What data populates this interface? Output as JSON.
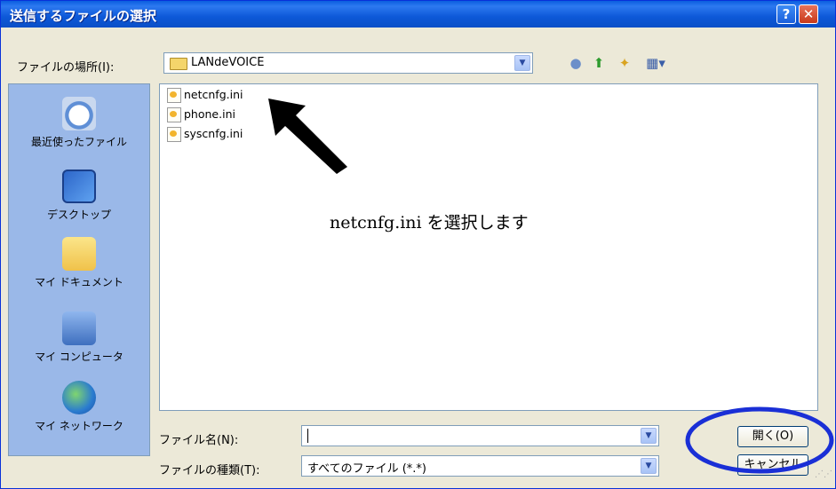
{
  "window": {
    "title": "送信するファイルの選択",
    "help_label": "?",
    "close_label": "✕"
  },
  "location": {
    "label": "ファイルの場所(I):",
    "value": "LANdeVOICE"
  },
  "toolbar_icons": [
    "back-icon",
    "up-folder-icon",
    "new-folder-icon",
    "view-menu-icon"
  ],
  "places": [
    {
      "label": "最近使ったファイル",
      "icon": "recent-icon"
    },
    {
      "label": "デスクトップ",
      "icon": "desktop-icon"
    },
    {
      "label": "マイ ドキュメント",
      "icon": "my-documents-icon"
    },
    {
      "label": "マイ コンピュータ",
      "icon": "my-computer-icon"
    },
    {
      "label": "マイ ネットワーク",
      "icon": "my-network-icon"
    }
  ],
  "files": [
    {
      "name": "netcnfg.ini"
    },
    {
      "name": "phone.ini"
    },
    {
      "name": "syscnfg.ini"
    }
  ],
  "annotation": {
    "text": "netcnfg.ini を選択します"
  },
  "filename": {
    "label": "ファイル名(N):",
    "value": ""
  },
  "filetype": {
    "label": "ファイルの種類(T):",
    "value": "すべてのファイル (*.*)"
  },
  "buttons": {
    "open": "開く(O)",
    "cancel": "キャンセル"
  },
  "colors": {
    "titlebar": "#0a5ddf",
    "dialog_bg": "#ece9d8",
    "places_bg": "#9ab8e8",
    "highlight_ellipse": "#1a2fd6",
    "arrow": "#000000"
  }
}
